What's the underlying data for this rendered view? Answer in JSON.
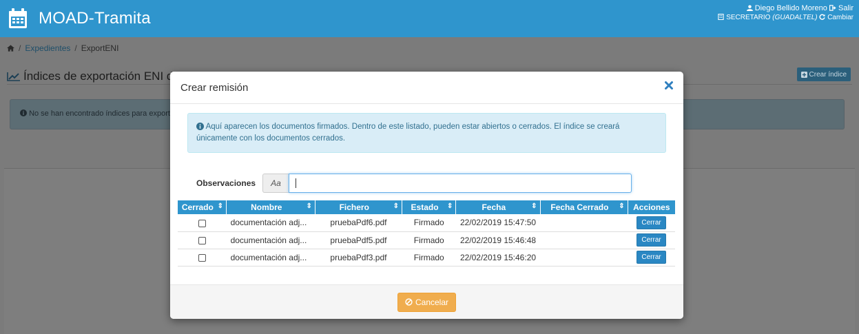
{
  "app": {
    "title": "MOAD-Tramita"
  },
  "user": {
    "name": "Diego Bellido Moreno",
    "logout_label": "Salir",
    "role": "SECRETARIO",
    "entity": "(GUADALTEL)",
    "change_label": "Cambiar"
  },
  "breadcrumb": {
    "items": [
      "Expedientes",
      "ExportENI"
    ]
  },
  "page": {
    "title": "Índices de exportación ENI del expediente",
    "create_index_label": "Crear índice",
    "empty_message": "No se han encontrado índices para exportar"
  },
  "modal": {
    "title": "Crear remisión",
    "info": "Aquí aparecen los documentos firmados. Dentro de este listado, pueden estar abiertos o cerrados. El índice se creará únicamente con los documentos cerrados.",
    "observaciones_label": "Observaciones",
    "observaciones_addon": "Aa",
    "observaciones_value": "",
    "cancel_label": "Cancelar"
  },
  "table": {
    "columns": [
      "Cerrado",
      "Nombre",
      "Fichero",
      "Estado",
      "Fecha",
      "Fecha Cerrado",
      "Acciones"
    ],
    "rows": [
      {
        "nombre": "documentación adj...",
        "fichero": "pruebaPdf6.pdf",
        "estado": "Firmado",
        "fecha": "22/02/2019 15:47:50",
        "fecha_cerrado": "",
        "accion": "Cerrar"
      },
      {
        "nombre": "documentación adj...",
        "fichero": "pruebaPdf5.pdf",
        "estado": "Firmado",
        "fecha": "22/02/2019 15:46:48",
        "fecha_cerrado": "",
        "accion": "Cerrar"
      },
      {
        "nombre": "documentación adj...",
        "fichero": "pruebaPdf3.pdf",
        "estado": "Firmado",
        "fecha": "22/02/2019 15:46:20",
        "fecha_cerrado": "",
        "accion": "Cerrar"
      }
    ]
  },
  "colors": {
    "primary": "#2f95cd",
    "info_bg": "#d9edf7",
    "info_text": "#31708f",
    "warning": "#f0ad4e"
  }
}
